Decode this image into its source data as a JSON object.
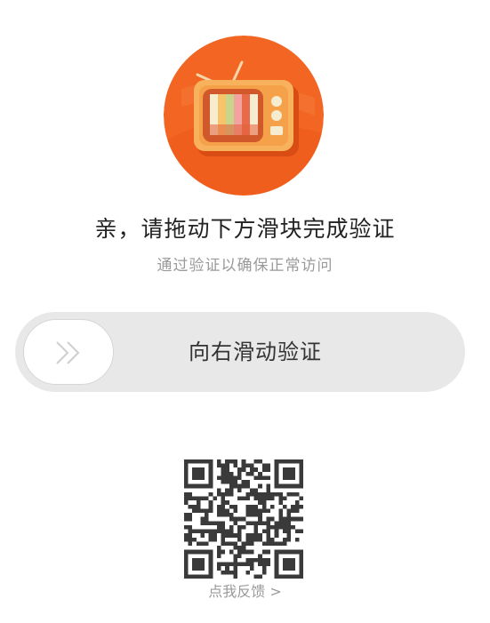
{
  "logo": {
    "icon": "tv-icon",
    "accent": "#f26522"
  },
  "header": {
    "title": "亲，请拖动下方滑块完成验证",
    "subtitle": "通过验证以确保正常访问"
  },
  "slider": {
    "label": "向右滑动验证",
    "handle_icon": "double-chevron-right-icon",
    "progress": 0,
    "track_color": "#e8e8e8"
  },
  "qr": {
    "icon": "qr-code-icon"
  },
  "feedback": {
    "label": "点我反馈 >"
  }
}
